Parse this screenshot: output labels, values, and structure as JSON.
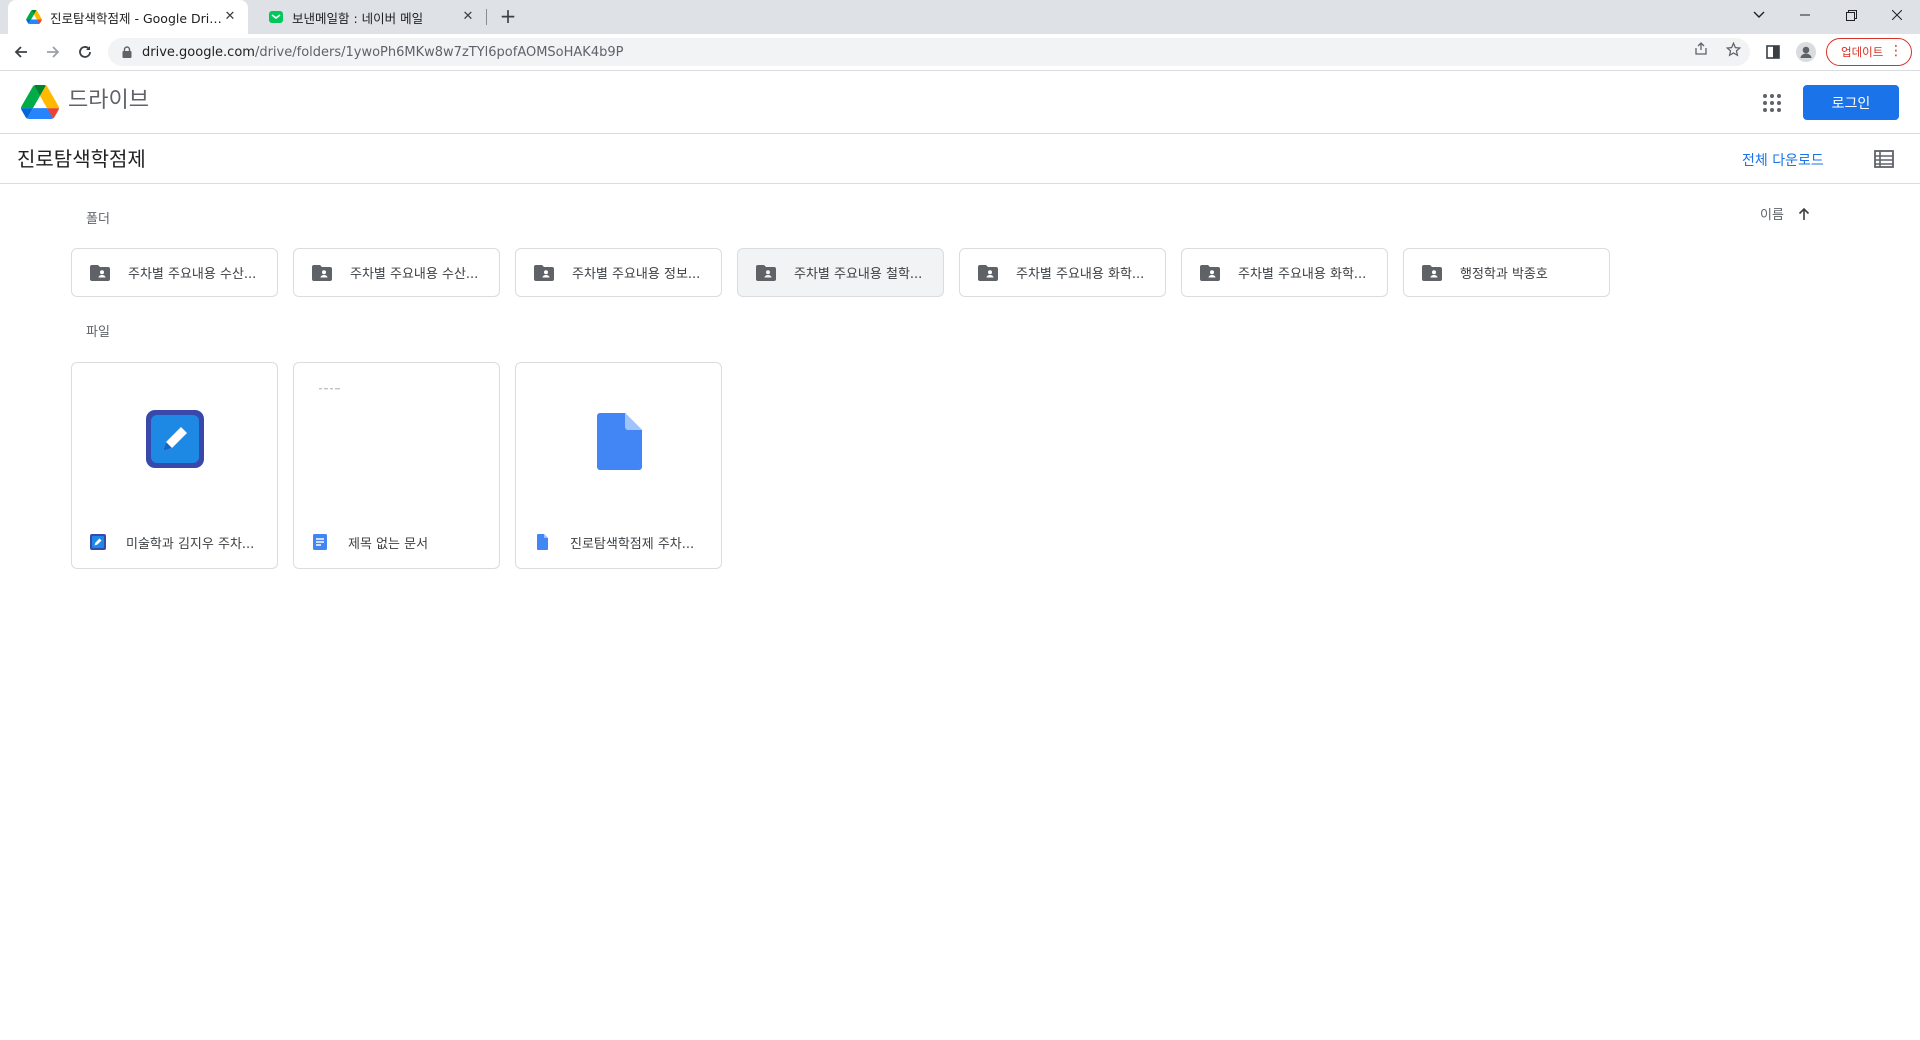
{
  "browser": {
    "tabs": [
      {
        "title": "진로탐색학점제 - Google Drive",
        "close": "✕"
      },
      {
        "title": "보낸메일함 : 네이버 메일",
        "close": "✕"
      }
    ],
    "new_tab": "+",
    "url_host": "drive.google.com",
    "url_path": "/drive/folders/1ywoPh6MKw8w7zTYl6pofAOMSoHAK4b9P",
    "update_label": "업데이트"
  },
  "header": {
    "app_name": "드라이브",
    "login_label": "로그인"
  },
  "folder_page": {
    "title": "진로탐색학점제",
    "download_all": "전체 다운로드"
  },
  "sections": {
    "folders_label": "폴더",
    "files_label": "파일",
    "sort_label": "이름"
  },
  "folders": [
    {
      "name": "주차별 주요내용 수산..."
    },
    {
      "name": "주차별 주요내용 수산..."
    },
    {
      "name": "주차별 주요내용 정보..."
    },
    {
      "name": "주차별 주요내용 철학..."
    },
    {
      "name": "주차별 주요내용 화학..."
    },
    {
      "name": "주차별 주요내용 화학..."
    },
    {
      "name": "행정학과 박종호"
    }
  ],
  "files": [
    {
      "name": "미술학과 김지우 주차...",
      "icon": "drawing-icon"
    },
    {
      "name": "제목 없는 문서",
      "icon": "docs-icon"
    },
    {
      "name": "진로탐색학점제 주차...",
      "icon": "file-icon"
    }
  ],
  "colors": {
    "accent": "#1a73e8",
    "update_red": "#d93025",
    "border": "#dadce0"
  }
}
